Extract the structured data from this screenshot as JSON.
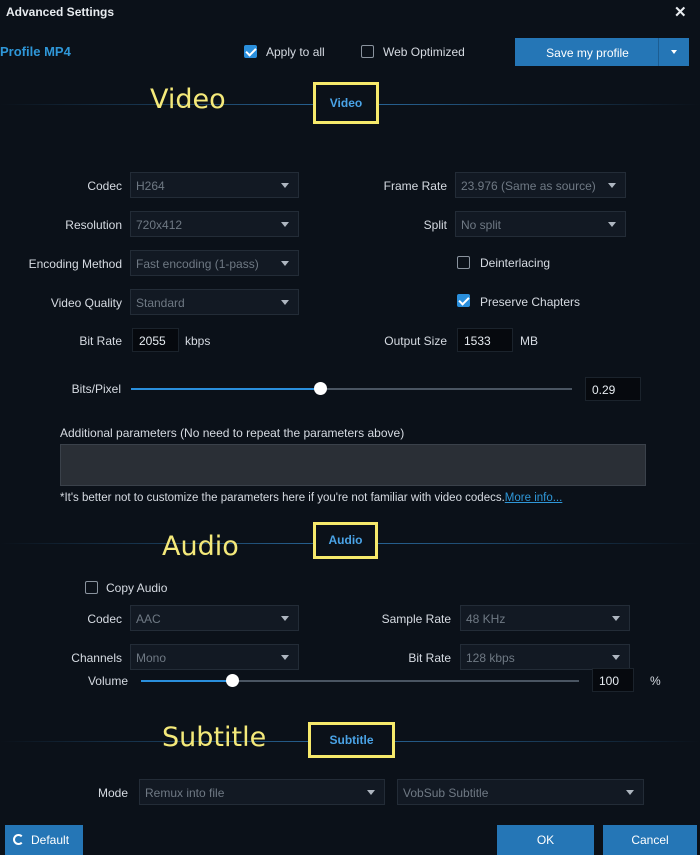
{
  "window": {
    "title": "Advanced Settings",
    "close_glyph": "✕"
  },
  "header": {
    "profile_label": "Profile MP4",
    "apply_to_all": {
      "label": "Apply to all",
      "checked": true
    },
    "web_optimized": {
      "label": "Web Optimized",
      "checked": false
    },
    "save_button": "Save my profile"
  },
  "annotations": {
    "video": "Video",
    "audio": "Audio",
    "subtitle": "Subtitle"
  },
  "video": {
    "section_tab": "Video",
    "codec": {
      "label": "Codec",
      "value": "H264"
    },
    "resolution": {
      "label": "Resolution",
      "value": "720x412"
    },
    "encoding_method": {
      "label": "Encoding Method",
      "value": "Fast encoding (1-pass)"
    },
    "video_quality": {
      "label": "Video Quality",
      "value": "Standard"
    },
    "bit_rate": {
      "label": "Bit Rate",
      "value": "2055",
      "unit": "kbps"
    },
    "frame_rate": {
      "label": "Frame Rate",
      "value": "23.976 (Same as source)"
    },
    "split": {
      "label": "Split",
      "value": "No split"
    },
    "deinterlacing": {
      "label": "Deinterlacing",
      "checked": false
    },
    "preserve_chapters": {
      "label": "Preserve Chapters",
      "checked": true
    },
    "output_size": {
      "label": "Output Size",
      "value": "1533",
      "unit": "MB"
    },
    "bits_pixel": {
      "label": "Bits/Pixel",
      "value": "0.29",
      "slider_fraction": 0.43
    },
    "additional_params_label": "Additional parameters (No need to repeat the parameters above)",
    "warning_text": "*It's better not to customize the parameters here if you're not familiar with video codecs.",
    "more_info_link": "More info..."
  },
  "audio": {
    "section_tab": "Audio",
    "copy_audio": {
      "label": "Copy Audio",
      "checked": false
    },
    "codec": {
      "label": "Codec",
      "value": "AAC"
    },
    "channels": {
      "label": "Channels",
      "value": "Mono"
    },
    "sample_rate": {
      "label": "Sample Rate",
      "value": "48 KHz"
    },
    "bit_rate": {
      "label": "Bit Rate",
      "value": "128 kbps"
    },
    "volume": {
      "label": "Volume",
      "value": "100",
      "unit": "%",
      "slider_fraction": 0.21
    }
  },
  "subtitle": {
    "section_tab": "Subtitle",
    "mode": {
      "label": "Mode",
      "value": "Remux into file"
    },
    "format": {
      "value": "VobSub Subtitle"
    }
  },
  "footer": {
    "default_button": "Default",
    "ok_button": "OK",
    "cancel_button": "Cancel"
  },
  "colors": {
    "accent": "#2576b6",
    "annotation": "#f6e96b",
    "background": "#0b1119"
  }
}
